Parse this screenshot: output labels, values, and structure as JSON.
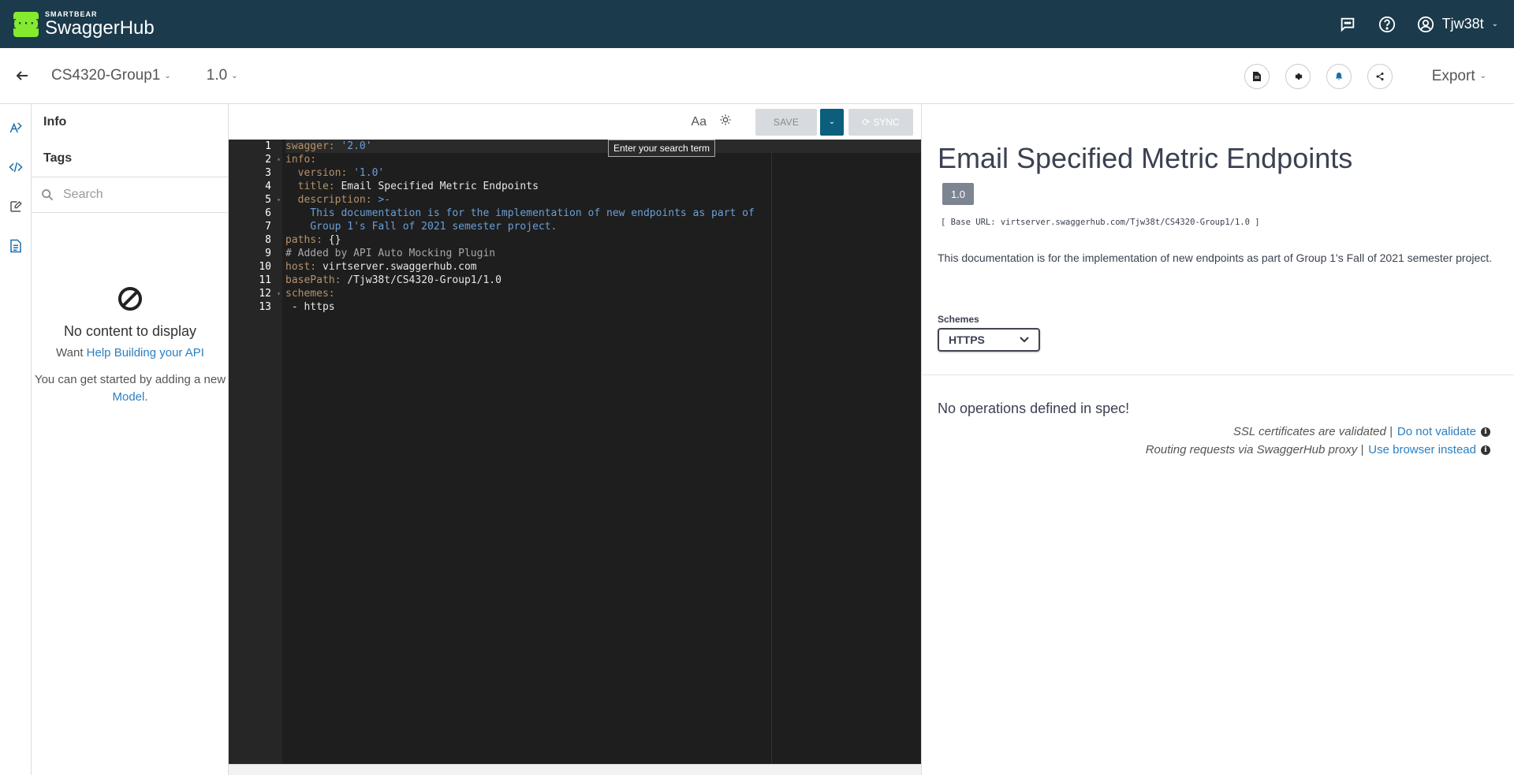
{
  "topbar": {
    "brand_sub": "SMARTBEAR",
    "brand_main": "SwaggerHub",
    "logo_glyph": "{···}",
    "username": "Tjw38t",
    "icons": [
      "chat-icon",
      "help-icon",
      "user-icon"
    ],
    "colors": {
      "background": "#1b3a4b",
      "logo": "#85ea2d"
    }
  },
  "subheader": {
    "api_name": "CS4320-Group1",
    "api_version": "1.0",
    "export_label": "Export",
    "circle_icons": [
      "document-icon",
      "gear-icon",
      "bell-icon",
      "share-icon"
    ]
  },
  "navpanel": {
    "items": [
      {
        "label": "Info"
      },
      {
        "label": "Tags"
      }
    ],
    "search_placeholder": "Search",
    "empty": {
      "title": "No content to display",
      "want": "Want ",
      "help_link": "Help Building your API",
      "started": "You can get started by adding a new",
      "model_link": "Model",
      "period": "."
    }
  },
  "editor": {
    "font_toggle": "Aa",
    "save_label": "SAVE",
    "sync_label": "SYNC",
    "tooltip": "Enter your search term",
    "lines": [
      {
        "n": "1",
        "fold": false,
        "parts": [
          [
            "k",
            "swagger: "
          ],
          [
            "s",
            "'2.0'"
          ]
        ]
      },
      {
        "n": "2",
        "fold": true,
        "parts": [
          [
            "k",
            "info:"
          ]
        ]
      },
      {
        "n": "3",
        "fold": false,
        "parts": [
          [
            "k",
            "  version: "
          ],
          [
            "s",
            "'1.0'"
          ]
        ]
      },
      {
        "n": "4",
        "fold": false,
        "parts": [
          [
            "k",
            "  title: "
          ],
          [
            "v",
            "Email Specified Metric Endpoints"
          ]
        ]
      },
      {
        "n": "5",
        "fold": true,
        "parts": [
          [
            "k",
            "  description: "
          ],
          [
            "s",
            ">-"
          ]
        ]
      },
      {
        "n": "6",
        "fold": false,
        "parts": [
          [
            "s",
            "    This documentation is for the implementation of new endpoints as part of"
          ]
        ]
      },
      {
        "n": "7",
        "fold": false,
        "parts": [
          [
            "s",
            "    Group 1's Fall of 2021 semester project."
          ]
        ]
      },
      {
        "n": "8",
        "fold": false,
        "parts": [
          [
            "k",
            "paths: "
          ],
          [
            "v",
            "{}"
          ]
        ]
      },
      {
        "n": "9",
        "fold": false,
        "parts": [
          [
            "c",
            "# Added by API Auto Mocking Plugin"
          ]
        ]
      },
      {
        "n": "10",
        "fold": false,
        "parts": [
          [
            "k",
            "host: "
          ],
          [
            "v",
            "virtserver.swaggerhub.com"
          ]
        ]
      },
      {
        "n": "11",
        "fold": false,
        "parts": [
          [
            "k",
            "basePath: "
          ],
          [
            "v",
            "/Tjw38t/CS4320-Group1/1.0"
          ]
        ]
      },
      {
        "n": "12",
        "fold": true,
        "parts": [
          [
            "k",
            "schemes:"
          ]
        ]
      },
      {
        "n": "13",
        "fold": false,
        "parts": [
          [
            "v",
            " - https"
          ]
        ]
      }
    ]
  },
  "doc": {
    "title": "Email Specified Metric Endpoints",
    "version_badge": "1.0",
    "base_url": "[ Base URL: virtserver.swaggerhub.com/Tjw38t/CS4320-Group1/1.0 ]",
    "description": "This documentation is for the implementation of new endpoints as part of Group 1's Fall of 2021 semester project.",
    "schemes_label": "Schemes",
    "schemes_value": "HTTPS",
    "no_ops": "No operations defined in spec!",
    "ssl_text": "SSL certificates are validated |",
    "ssl_link": "Do not validate",
    "proxy_text": "Routing requests via SwaggerHub proxy |",
    "proxy_link": "Use browser instead"
  }
}
